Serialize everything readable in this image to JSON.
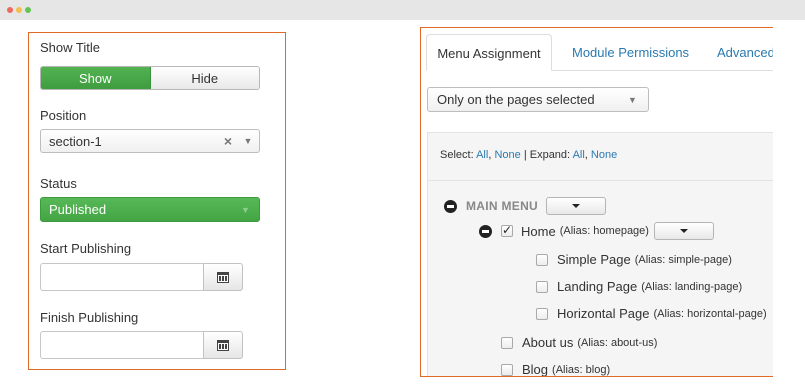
{
  "colors": {
    "panel_border": "#e06a23",
    "active_green": "#44a544",
    "link_blue": "#2a7ab0"
  },
  "left": {
    "show_title": {
      "label": "Show Title",
      "options": [
        "Show",
        "Hide"
      ],
      "selected": "Show"
    },
    "position": {
      "label": "Position",
      "value": "section-1",
      "clear_icon": "close-icon"
    },
    "status": {
      "label": "Status",
      "value": "Published"
    },
    "start_publishing": {
      "label": "Start Publishing",
      "value": ""
    },
    "finish_publishing": {
      "label": "Finish Publishing",
      "value": ""
    }
  },
  "right": {
    "tabs": [
      {
        "label": "Menu Assignment",
        "active": true
      },
      {
        "label": "Module Permissions",
        "active": false
      },
      {
        "label": "Advanced",
        "active": false
      }
    ],
    "pages_select": "Only on the pages selected",
    "select_bar": {
      "select_label": "Select:",
      "all": "All",
      "comma": ",",
      "none": "None",
      "divider": "|",
      "expand_label": "Expand:"
    },
    "menu": {
      "title": "MAIN MENU",
      "items": [
        {
          "label": "Home",
          "alias": "(Alias: homepage)",
          "checked": true,
          "collapsible": true
        },
        {
          "label": "Simple Page",
          "alias": "(Alias: simple-page)",
          "checked": false
        },
        {
          "label": "Landing Page",
          "alias": "(Alias: landing-page)",
          "checked": false
        },
        {
          "label": "Horizontal Page",
          "alias": "(Alias: horizontal-page)",
          "checked": false
        },
        {
          "label": "About us",
          "alias": "(Alias: about-us)",
          "checked": false
        },
        {
          "label": "Blog",
          "alias": "(Alias: blog)",
          "checked": false
        }
      ]
    }
  }
}
